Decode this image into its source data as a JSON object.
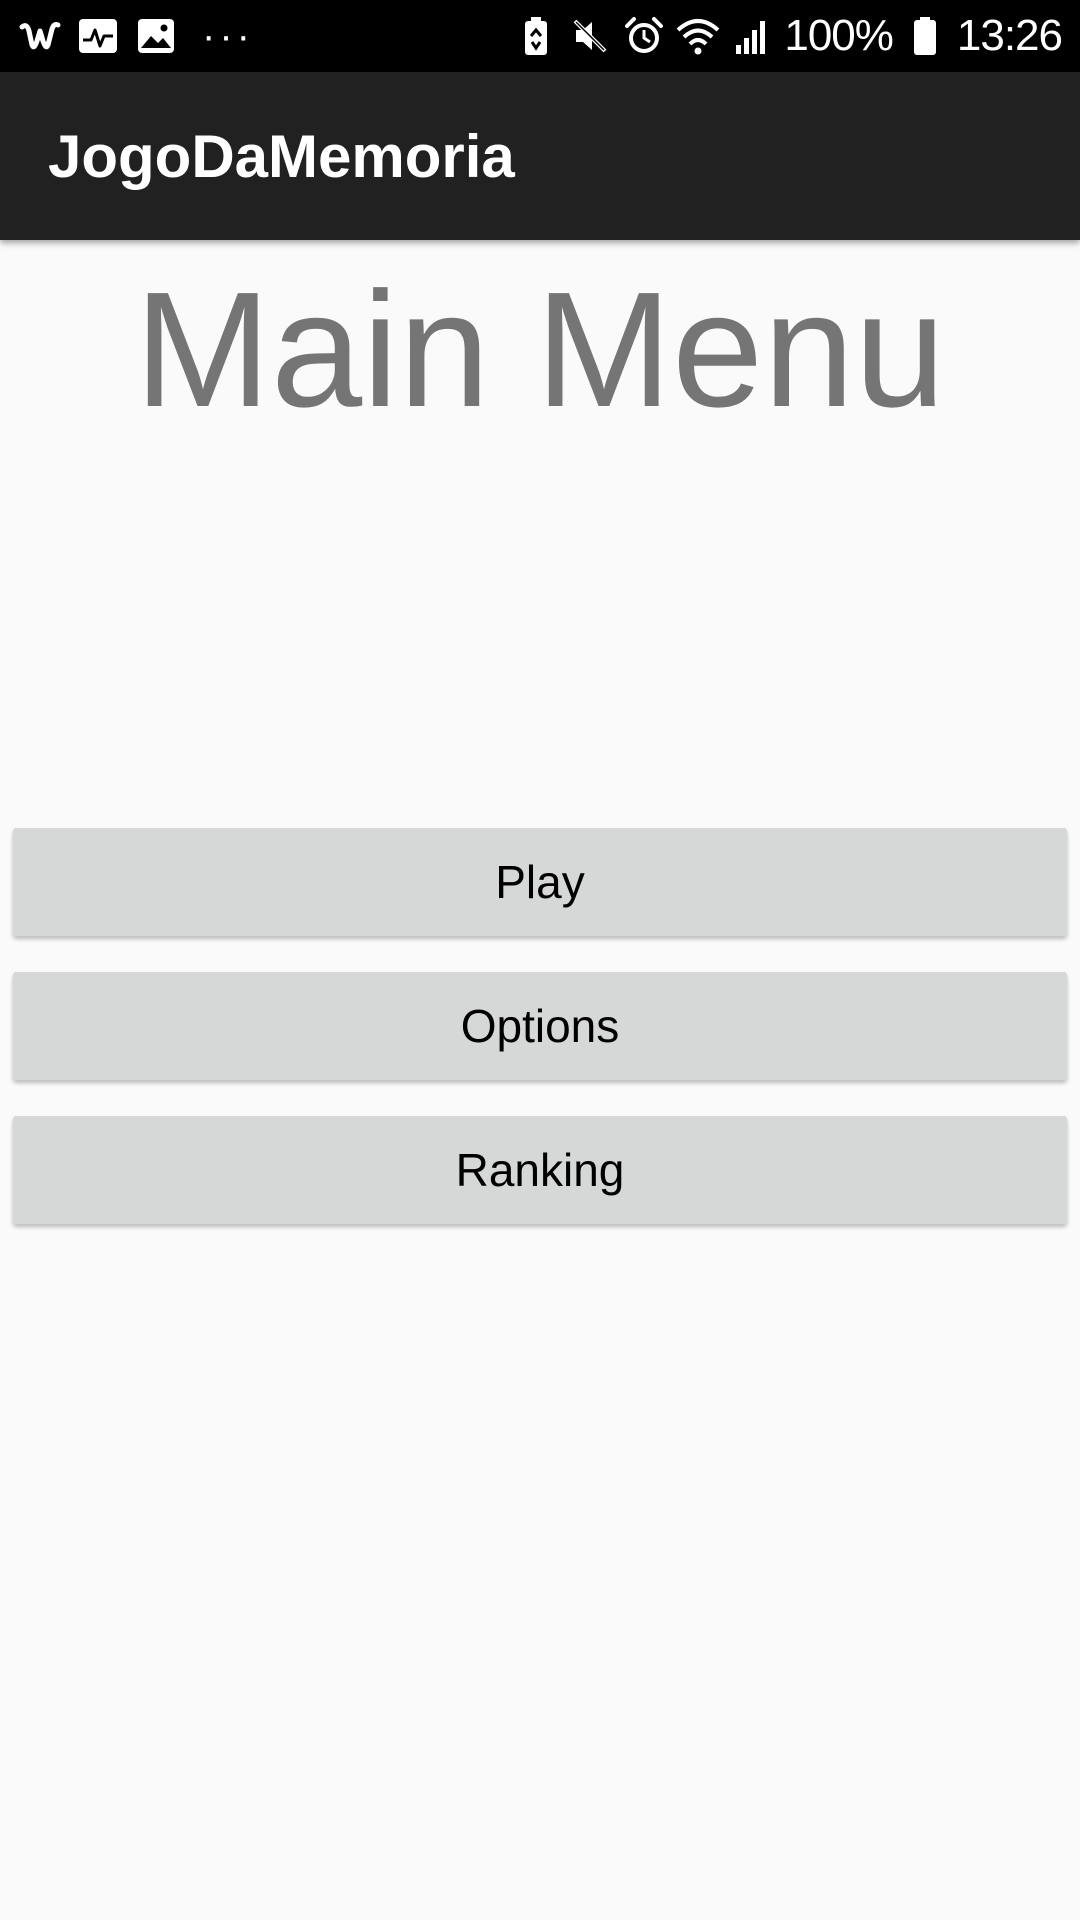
{
  "status_bar": {
    "left_icons": [
      "wish-icon",
      "health-icon",
      "gallery-icon"
    ],
    "more_label": "···",
    "right_icons": [
      "battery-saver-icon",
      "mute-icon",
      "alarm-icon",
      "wifi-icon",
      "signal-icon"
    ],
    "battery_percent": "100%",
    "battery_icon": "battery-icon",
    "time": "13:26"
  },
  "app_bar": {
    "title": "JogoDaMemoria",
    "background": "#212121"
  },
  "main": {
    "title": "Main Menu",
    "title_color": "#757575",
    "buttons": [
      {
        "label": "Play"
      },
      {
        "label": "Options"
      },
      {
        "label": "Ranking"
      }
    ],
    "button_color": "#d6d7d7"
  }
}
